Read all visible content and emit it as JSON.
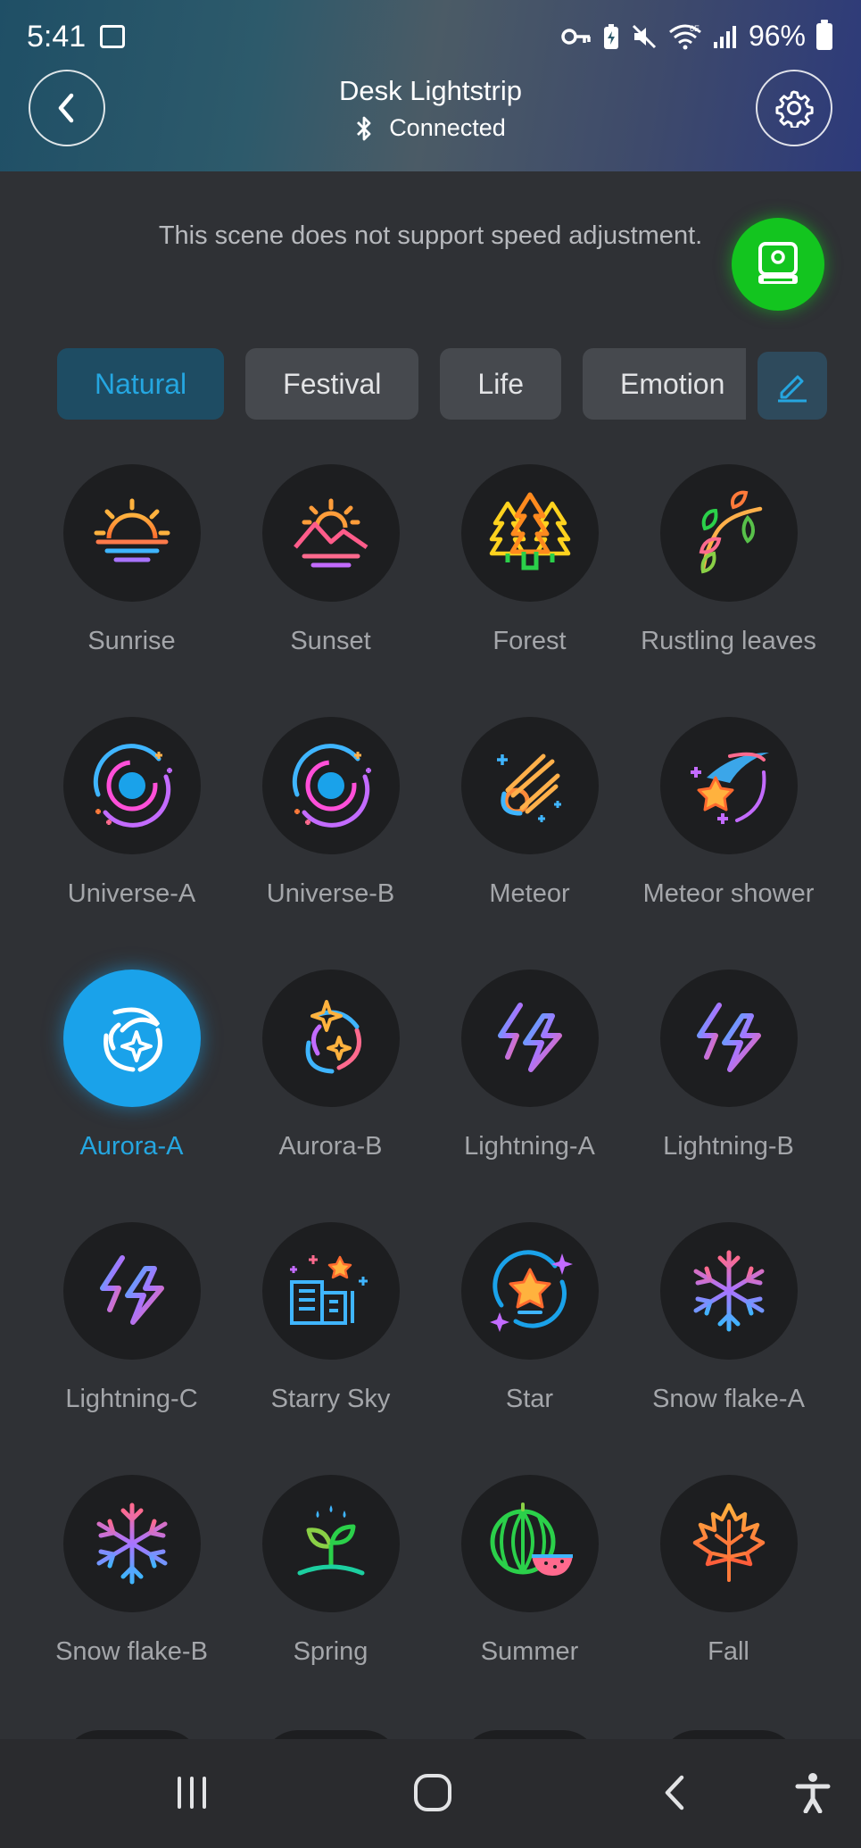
{
  "status_bar": {
    "time": "5:41",
    "battery": "96%"
  },
  "header": {
    "title": "Desk Lightstrip",
    "subtitle": "Connected"
  },
  "notice": "This scene does not support speed adjustment.",
  "tabs": [
    {
      "label": "Natural",
      "active": true
    },
    {
      "label": "Festival",
      "active": false
    },
    {
      "label": "Life",
      "active": false
    },
    {
      "label": "Emotion",
      "active": false
    }
  ],
  "scenes": [
    {
      "label": "Sunrise",
      "icon": "sunrise-icon"
    },
    {
      "label": "Sunset",
      "icon": "sunset-icon"
    },
    {
      "label": "Forest",
      "icon": "forest-icon"
    },
    {
      "label": "Rustling leaves",
      "icon": "leaves-icon"
    },
    {
      "label": "Universe-A",
      "icon": "galaxy-icon"
    },
    {
      "label": "Universe-B",
      "icon": "galaxy-icon"
    },
    {
      "label": "Meteor",
      "icon": "meteor-icon"
    },
    {
      "label": "Meteor shower",
      "icon": "shooting-star-icon"
    },
    {
      "label": "Aurora-A",
      "icon": "aurora-icon",
      "selected": true
    },
    {
      "label": "Aurora-B",
      "icon": "aurora-icon"
    },
    {
      "label": "Lightning-A",
      "icon": "lightning-icon"
    },
    {
      "label": "Lightning-B",
      "icon": "lightning-icon"
    },
    {
      "label": "Lightning-C",
      "icon": "lightning-icon"
    },
    {
      "label": "Starry Sky",
      "icon": "city-stars-icon"
    },
    {
      "label": "Star",
      "icon": "star-icon"
    },
    {
      "label": "Snow flake-A",
      "icon": "snowflake-icon"
    },
    {
      "label": "Snow flake-B",
      "icon": "snowflake-icon"
    },
    {
      "label": "Spring",
      "icon": "sprout-icon"
    },
    {
      "label": "Summer",
      "icon": "watermelon-icon"
    },
    {
      "label": "Fall",
      "icon": "maple-leaf-icon"
    }
  ],
  "colors": {
    "accent": "#25a6e0",
    "fab": "#13c51f",
    "background": "#2f3135"
  }
}
